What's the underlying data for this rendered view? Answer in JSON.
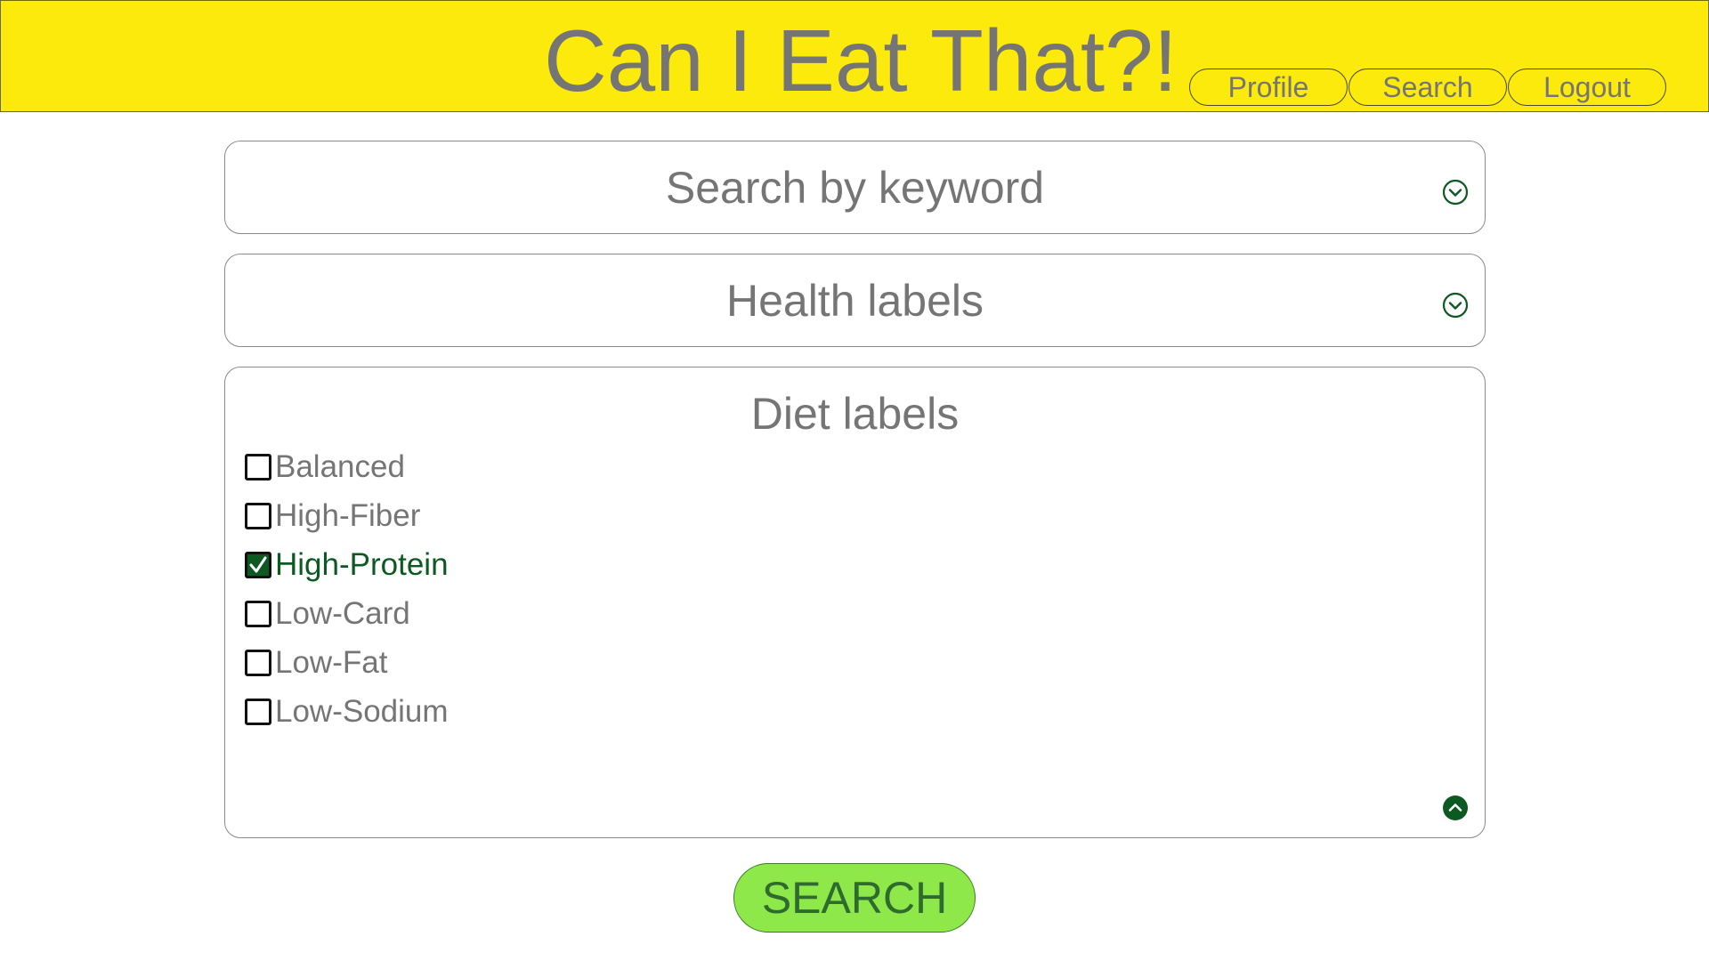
{
  "header": {
    "title": "Can I Eat That?!",
    "background_color": "#fbea0b",
    "nav": {
      "profile": "Profile",
      "search": "Search",
      "logout": "Logout"
    }
  },
  "filters": {
    "keyword": {
      "label": "Search by keyword",
      "icon": "chevron-down-circle-icon"
    },
    "health": {
      "label": "Health labels",
      "icon": "chevron-down-circle-icon"
    },
    "diet": {
      "label": "Diet labels",
      "icon": "chevron-up-circle-icon",
      "options": [
        {
          "label": "Balanced",
          "checked": false
        },
        {
          "label": "High-Fiber",
          "checked": false
        },
        {
          "label": "High-Protein",
          "checked": true
        },
        {
          "label": "Low-Card",
          "checked": false
        },
        {
          "label": "Low-Fat",
          "checked": false
        },
        {
          "label": "Low-Sodium",
          "checked": false
        }
      ]
    }
  },
  "submit": {
    "label": "SEARCH",
    "background_color": "#8ee84a"
  },
  "colors": {
    "accent_green": "#0c5a22",
    "text_gray": "#757575"
  }
}
